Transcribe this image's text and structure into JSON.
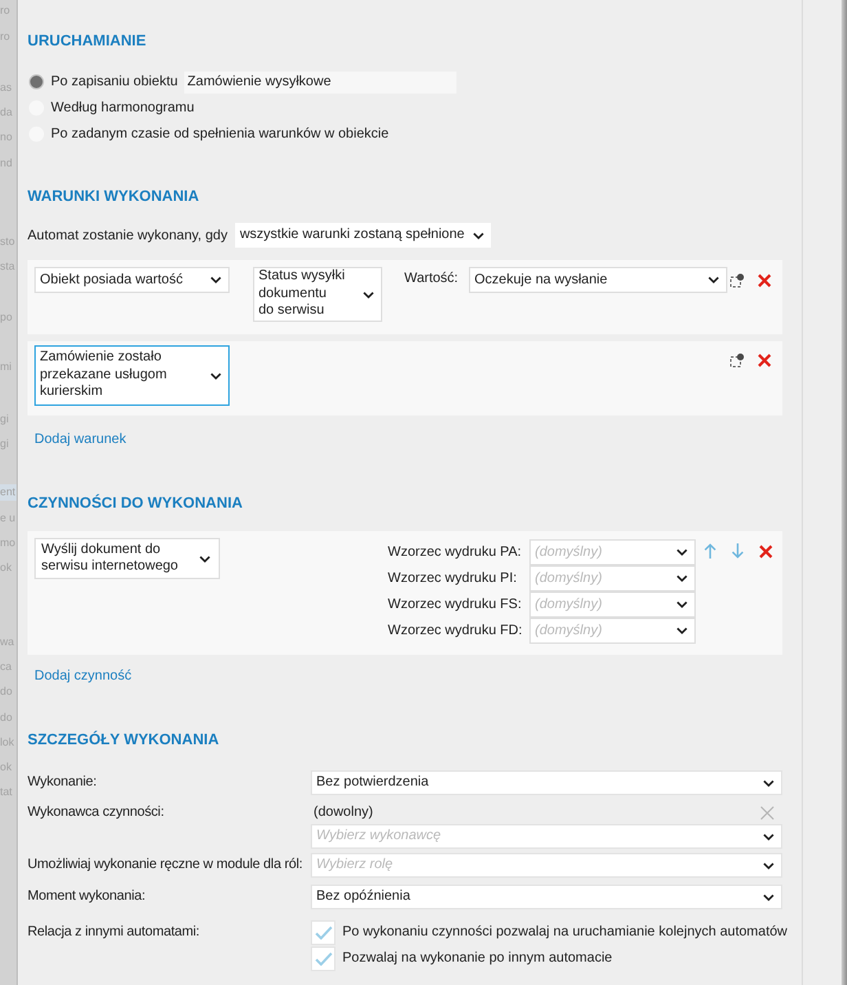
{
  "background_window": {
    "fragments": [
      {
        "text": "ro",
        "selected": false
      },
      {
        "text": "ro",
        "selected": false
      },
      {
        "text": "as",
        "selected": false
      },
      {
        "text": "da",
        "selected": false
      },
      {
        "text": "no",
        "selected": false
      },
      {
        "text": "nd",
        "selected": false
      },
      {
        "text": "sto",
        "selected": false
      },
      {
        "text": "sta",
        "selected": false
      },
      {
        "text": "po",
        "selected": false
      },
      {
        "text": "mi",
        "selected": false
      },
      {
        "text": "gi",
        "selected": false
      },
      {
        "text": "gi",
        "selected": false
      },
      {
        "text": "ent",
        "selected": true
      },
      {
        "text": "e u",
        "selected": false
      },
      {
        "text": "mo",
        "selected": false
      },
      {
        "text": "ok",
        "selected": false
      },
      {
        "text": "wa",
        "selected": false
      },
      {
        "text": "ca",
        "selected": false
      },
      {
        "text": "do",
        "selected": false
      },
      {
        "text": "do",
        "selected": false
      },
      {
        "text": "lok",
        "selected": false
      },
      {
        "text": "ok",
        "selected": false
      },
      {
        "text": "tat",
        "selected": false
      }
    ]
  },
  "launch": {
    "title": "URUCHAMIANIE",
    "options": [
      {
        "label": "Po zapisaniu obiektu",
        "selected": true,
        "object_field": "Zamówienie wysyłkowe"
      },
      {
        "label": "Według harmonogramu",
        "selected": false
      },
      {
        "label": "Po zadanym czasie od spełnienia warunków w obiekcie",
        "selected": false
      }
    ]
  },
  "conditions": {
    "title": "WARUNKI WYKONANIA",
    "mode_label": "Automat zostanie wykonany, gdy",
    "mode_value": "wszystkie warunki zostaną spełnione",
    "items": [
      {
        "subject": "Obiekt posiada wartość",
        "subject_focused": false,
        "property": "Status wysyłki\ndokumentu\ndo serwisu",
        "value_label": "Wartość:",
        "value": "Oczekuje na wysłanie"
      },
      {
        "subject": "Zamówienie zostało przekazane usługom kurierskim",
        "subject_focused": true
      }
    ],
    "add_link": "Dodaj warunek"
  },
  "actions": {
    "title": "CZYNNOŚCI DO WYKONANIA",
    "items": [
      {
        "action": "Wyślij dokument do serwisu internetowego",
        "templates": [
          {
            "label": "Wzorzec wydruku PA:",
            "placeholder": "(domyślny)"
          },
          {
            "label": "Wzorzec wydruku PI:",
            "placeholder": "(domyślny)"
          },
          {
            "label": "Wzorzec wydruku FS:",
            "placeholder": "(domyślny)"
          },
          {
            "label": "Wzorzec wydruku FD:",
            "placeholder": "(domyślny)"
          }
        ]
      }
    ],
    "add_link": "Dodaj czynność"
  },
  "details": {
    "title": "SZCZEGÓŁY WYKONANIA",
    "rows": [
      {
        "kind": "select",
        "label": "Wykonanie:",
        "value": "Bez potwierdzenia"
      },
      {
        "kind": "picker",
        "label": "Wykonawca czynności:",
        "value": "(dowolny)",
        "placeholder": "Wybierz wykonawcę"
      },
      {
        "kind": "select",
        "label": "Umożliwiaj wykonanie ręczne w module dla ról:",
        "placeholder": "Wybierz rolę"
      },
      {
        "kind": "select",
        "label": "Moment wykonania:",
        "value": "Bez opóźnienia"
      },
      {
        "kind": "checks",
        "label": "Relacja z innymi automatami:",
        "options": [
          {
            "label": "Po wykonaniu czynności pozwalaj na uruchamianie kolejnych automatów",
            "checked": true
          },
          {
            "label": "Pozwalaj na wykonanie po innym automacie",
            "checked": true
          }
        ]
      }
    ]
  }
}
